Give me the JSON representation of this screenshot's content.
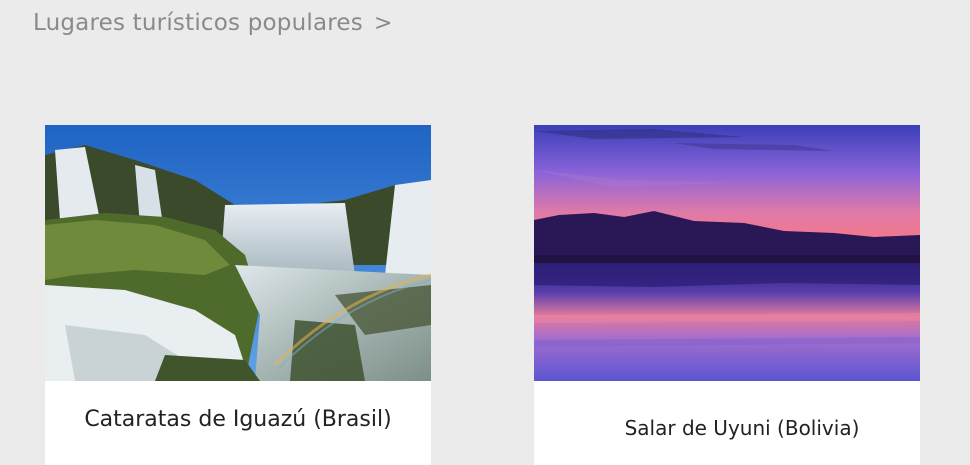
{
  "section": {
    "title": "Lugares turísticos populares",
    "chevron": ">"
  },
  "cards": [
    {
      "caption": "Cataratas de Iguazú (Brasil)",
      "image": "waterfall-photo"
    },
    {
      "caption": "Salar de Uyuni (Bolivia)",
      "image": "salt-flat-sunset-photo"
    }
  ],
  "colors": {
    "background": "#ebebeb",
    "card": "#ffffff",
    "header_text": "#8a8a8a",
    "caption_text": "#222222"
  }
}
